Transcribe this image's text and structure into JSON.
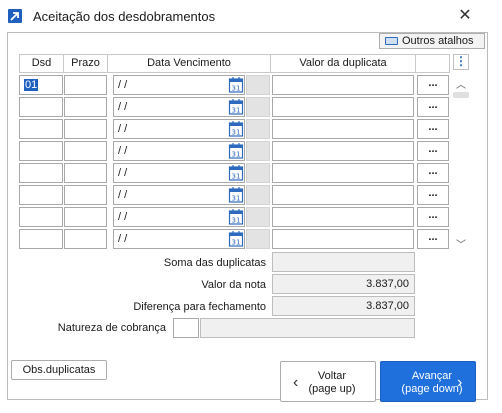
{
  "window": {
    "title": "Aceitação dos desdobramentos",
    "close_glyph": "✕",
    "icon": "arrow-up-right-icon"
  },
  "toolbar": {
    "atalhos_label": "Outros atalhos"
  },
  "grid": {
    "columns": [
      "Dsd",
      "Prazo",
      "Data Vencimento",
      "Valor da duplicata"
    ],
    "more_glyph": "⋮",
    "rows": [
      {
        "dsd": "01",
        "prazo": "",
        "data": " /  /",
        "valor": ""
      },
      {
        "dsd": "",
        "prazo": "",
        "data": " /  /",
        "valor": ""
      },
      {
        "dsd": "",
        "prazo": "",
        "data": " /  /",
        "valor": ""
      },
      {
        "dsd": "",
        "prazo": "",
        "data": " /  /",
        "valor": ""
      },
      {
        "dsd": "",
        "prazo": "",
        "data": " /  /",
        "valor": ""
      },
      {
        "dsd": "",
        "prazo": "",
        "data": " /  /",
        "valor": ""
      },
      {
        "dsd": "",
        "prazo": "",
        "data": " /  /",
        "valor": ""
      },
      {
        "dsd": "",
        "prazo": "",
        "data": " /  /",
        "valor": ""
      }
    ],
    "dots_label": "...",
    "calendar_day": "31"
  },
  "summary": {
    "soma_label": "Soma das duplicatas",
    "soma_value": "",
    "valor_nota_label": "Valor da nota",
    "valor_nota_value": "3.837,00",
    "diferenca_label": "Diferença para fechamento",
    "diferenca_value": "3.837,00",
    "natureza_label": "Natureza de cobrança",
    "natureza_code": "",
    "natureza_desc": ""
  },
  "footer": {
    "obs_label": "Obs.duplicatas",
    "voltar_label": "Voltar",
    "voltar_sub": "(page up)",
    "avancar_label": "Avançar",
    "avancar_sub": "(page down)"
  },
  "colors": {
    "accent": "#1f6fdc",
    "selection": "#1f5fbf"
  }
}
